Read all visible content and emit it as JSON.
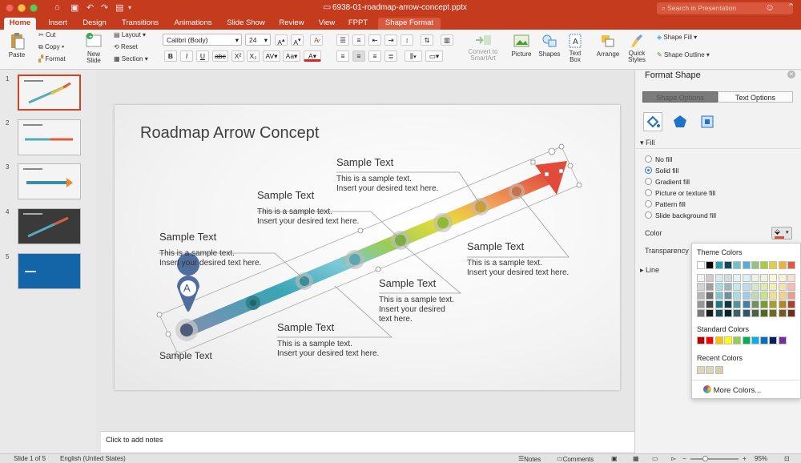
{
  "window": {
    "title": "6938-01-roadmap-arrow-concept.pptx",
    "search_placeholder": "Search in Presentation"
  },
  "tabs": [
    {
      "label": "Home",
      "active": true
    },
    {
      "label": "Insert"
    },
    {
      "label": "Design"
    },
    {
      "label": "Transitions"
    },
    {
      "label": "Animations"
    },
    {
      "label": "Slide Show"
    },
    {
      "label": "Review"
    },
    {
      "label": "View"
    },
    {
      "label": "FPPT"
    },
    {
      "label": "Shape Format",
      "contextual": true
    }
  ],
  "ribbon": {
    "paste": "Paste",
    "cut": "Cut",
    "copy": "Copy",
    "format": "Format",
    "new_slide": "New Slide",
    "layout": "Layout",
    "reset": "Reset",
    "section": "Section",
    "font_name": "Calibri (Body)",
    "font_size": "24",
    "convert_smartart": "Convert to SmartArt",
    "picture": "Picture",
    "shapes": "Shapes",
    "text_box": "Text Box",
    "arrange": "Arrange",
    "quick_styles": "Quick Styles",
    "shape_fill": "Shape Fill",
    "shape_outline": "Shape Outline"
  },
  "slides": [
    {
      "number": "1",
      "selected": true
    },
    {
      "number": "2"
    },
    {
      "number": "3"
    },
    {
      "number": "4"
    },
    {
      "number": "5"
    }
  ],
  "slide": {
    "title": "Roadmap Arrow Concept",
    "marker_letter": "A",
    "bottom_label": "Sample Text",
    "blocks": [
      {
        "heading": "Sample Text",
        "line1": "This is a sample text.",
        "line2": "Insert your desired text here."
      },
      {
        "heading": "Sample Text",
        "line1": "This is a sample text.",
        "line2": "Insert your desired text here."
      },
      {
        "heading": "Sample Text",
        "line1": "This is a sample text.",
        "line2": "Insert your desired text here."
      },
      {
        "heading": "Sample Text",
        "line1": "This is a sample text.",
        "line2": "Insert your desired text here."
      },
      {
        "heading": "Sample Text",
        "line1": "This is a sample text.",
        "line2": "Insert your desired",
        "line3": "text here."
      },
      {
        "heading": "Sample Text",
        "line1": "This is a sample text.",
        "line2": "Insert your desired text here."
      }
    ]
  },
  "notes_placeholder": "Click to add notes",
  "format_pane": {
    "title": "Format Shape",
    "tab_shape": "Shape Options",
    "tab_text": "Text Options",
    "fill_section": "Fill",
    "options": [
      "No fill",
      "Solid fill",
      "Gradient fill",
      "Picture or texture fill",
      "Pattern fill",
      "Slide background fill"
    ],
    "selected_option": "Solid fill",
    "color_label": "Color",
    "transparency_label": "Transparency",
    "line_section": "Line"
  },
  "color_popup": {
    "theme_title": "Theme Colors",
    "standard_title": "Standard Colors",
    "recent_title": "Recent Colors",
    "more": "More Colors...",
    "theme_top": [
      "#ffffff",
      "#000000",
      "#2b9dae",
      "#0c4a5e",
      "#6fc3c9",
      "#5aabd6",
      "#93c47d",
      "#a3cf3e",
      "#e2d13f",
      "#f0b233",
      "#e05a3c"
    ],
    "standard": [
      "#c00000",
      "#ff0000",
      "#ffc000",
      "#ffff00",
      "#92d050",
      "#00b050",
      "#00b0f0",
      "#0070c0",
      "#002060",
      "#7030a0"
    ],
    "recent": [
      "#ddd6b8",
      "#ddd6b8",
      "#d8cfa8"
    ]
  },
  "status": {
    "slide_of": "Slide 1 of 5",
    "language": "English (United States)",
    "notes": "Notes",
    "comments": "Comments",
    "zoom": "95%"
  }
}
